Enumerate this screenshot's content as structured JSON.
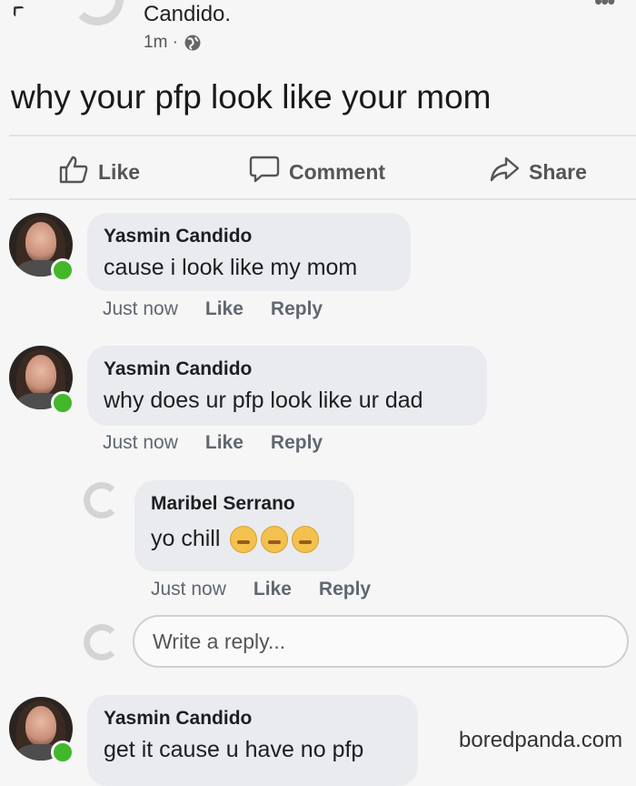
{
  "post": {
    "author": "Candido.",
    "time": "1m ·",
    "text": "why your pfp look like your mom"
  },
  "actions": {
    "like": "Like",
    "comment": "Comment",
    "share": "Share"
  },
  "comments": [
    {
      "name": "Yasmin Candido",
      "text": "cause i look like my mom",
      "time": "Just now",
      "like": "Like",
      "reply": "Reply"
    },
    {
      "name": "Yasmin Candido",
      "text": "why does ur pfp look like ur dad",
      "time": "Just now",
      "like": "Like",
      "reply": "Reply"
    },
    {
      "name": "Maribel Serrano",
      "text": "yo chill",
      "time": "Just now",
      "like": "Like",
      "reply": "Reply"
    },
    {
      "name": "Yasmin Candido",
      "text": "get it cause u have no pfp"
    }
  ],
  "reply_input": {
    "placeholder": "Write a reply..."
  },
  "watermark": "boredpanda.com",
  "colors": {
    "online": "#42b72a",
    "bubble": "#e9ebee"
  },
  "icons": [
    "back-icon",
    "globe-icon",
    "more-icon",
    "thumbs-up-icon",
    "comment-icon",
    "share-icon",
    "online-dot",
    "emoji-icon"
  ]
}
